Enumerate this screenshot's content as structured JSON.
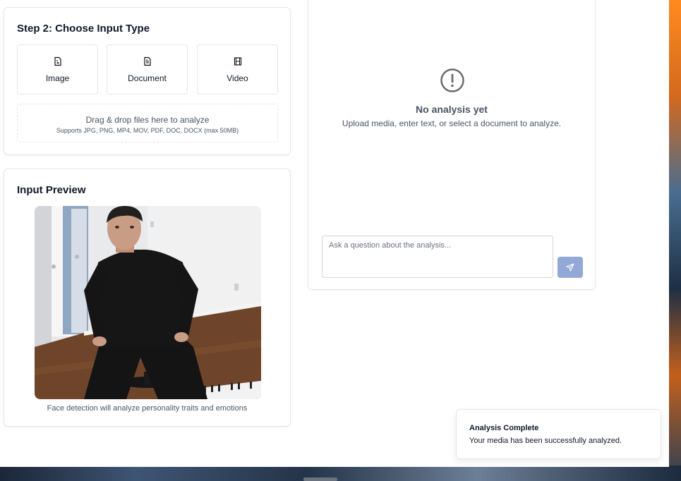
{
  "step2": {
    "title": "Step 2: Choose Input Type",
    "types": [
      {
        "label": "Image",
        "icon": "image-file-icon"
      },
      {
        "label": "Document",
        "icon": "document-icon"
      },
      {
        "label": "Video",
        "icon": "film-icon"
      }
    ],
    "dropzone": {
      "main": "Drag & drop files here to analyze",
      "sub": "Supports JPG, PNG, MP4, MOV, PDF, DOC, DOCX (max 50MB)"
    }
  },
  "preview": {
    "title": "Input Preview",
    "caption": "Face detection will analyze personality traits and emotions"
  },
  "analysis": {
    "empty_title": "No analysis yet",
    "empty_sub": "Upload media, enter text, or select a document to analyze.",
    "question_placeholder": "Ask a question about the analysis..."
  },
  "toast": {
    "title": "Analysis Complete",
    "message": "Your media has been successfully analyzed."
  },
  "colors": {
    "send_button": "#93a8d6",
    "border": "#e5e7eb",
    "muted_text": "#4b5563"
  }
}
